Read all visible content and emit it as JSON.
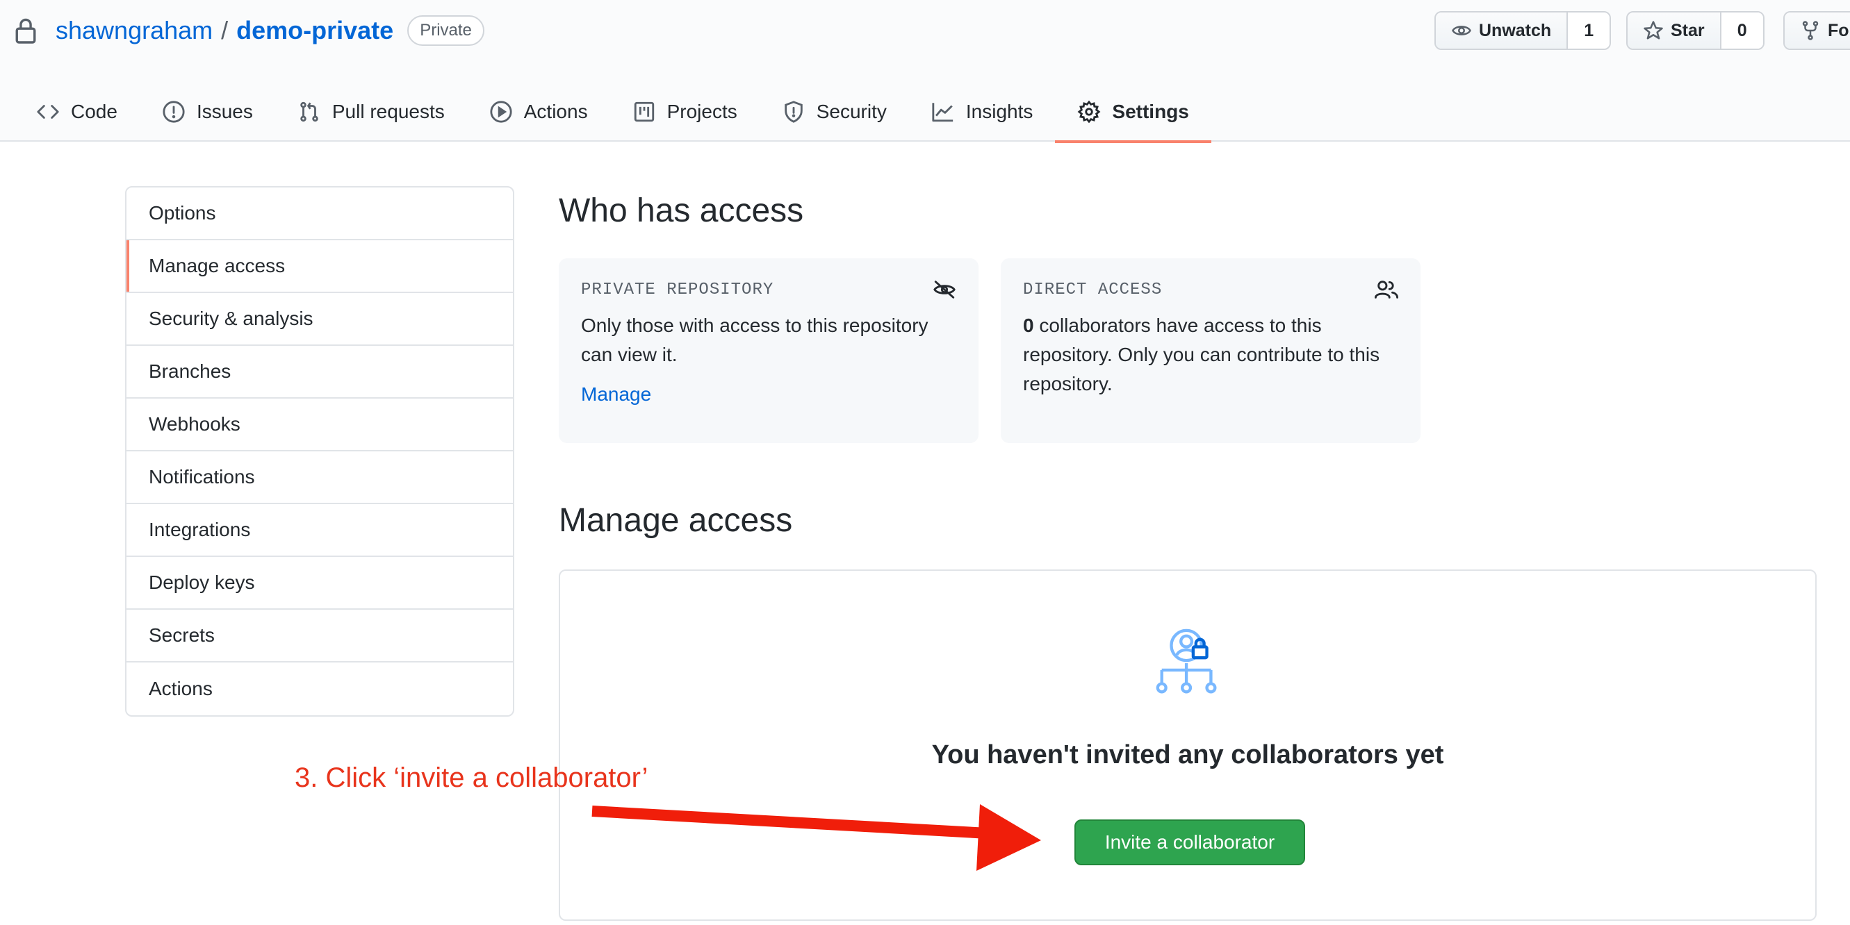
{
  "repo": {
    "owner": "shawngraham",
    "separator": "/",
    "name": "demo-private",
    "visibility_badge": "Private"
  },
  "header_actions": {
    "watch_label": "Unwatch",
    "watch_count": "1",
    "star_label": "Star",
    "star_count": "0",
    "fork_label": "For"
  },
  "tabs": [
    {
      "label": "Code",
      "icon": "code-icon"
    },
    {
      "label": "Issues",
      "icon": "issue-icon"
    },
    {
      "label": "Pull requests",
      "icon": "pull-request-icon"
    },
    {
      "label": "Actions",
      "icon": "play-icon"
    },
    {
      "label": "Projects",
      "icon": "project-icon"
    },
    {
      "label": "Security",
      "icon": "shield-icon"
    },
    {
      "label": "Insights",
      "icon": "graph-icon"
    },
    {
      "label": "Settings",
      "icon": "gear-icon",
      "selected": true
    }
  ],
  "settings_menu": [
    {
      "label": "Options"
    },
    {
      "label": "Manage access",
      "selected": true
    },
    {
      "label": "Security & analysis"
    },
    {
      "label": "Branches"
    },
    {
      "label": "Webhooks"
    },
    {
      "label": "Notifications"
    },
    {
      "label": "Integrations"
    },
    {
      "label": "Deploy keys"
    },
    {
      "label": "Secrets"
    },
    {
      "label": "Actions"
    }
  ],
  "who_has_access": {
    "heading": "Who has access",
    "private_card": {
      "title": "PRIVATE REPOSITORY",
      "icon": "eye-closed-icon",
      "body": "Only those with access to this repository can view it.",
      "link": "Manage"
    },
    "direct_card": {
      "title": "DIRECT ACCESS",
      "icon": "people-icon",
      "count": "0",
      "body": "collaborators have access to this repository. Only you can contribute to this repository."
    }
  },
  "manage_access": {
    "heading": "Manage access",
    "blankslate_icon": "person-lock-org-icon",
    "blankslate_title": "You haven't invited any collaborators yet",
    "invite_button": "Invite a collaborator"
  },
  "annotation": {
    "text": "3. Click ‘invite a collaborator’",
    "color": "#e8341c"
  },
  "colors": {
    "link": "#0366d6",
    "tab_underline": "#f9826c",
    "primary_button": "#2ea44f"
  }
}
